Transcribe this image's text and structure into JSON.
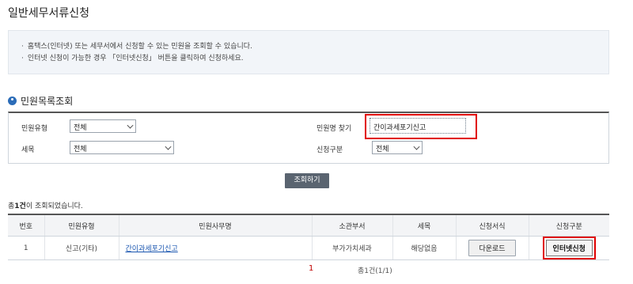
{
  "page_title": "일반세무서류신청",
  "notice": [
    "홈택스(인터넷) 또는 세무서에서 신청할 수 있는 민원을 조회할 수 있습니다.",
    "인터넷 신청이 가능한 경우 「인터넷신청」 버튼을 클릭하여 신청하세요."
  ],
  "section_title": "민원목록조회",
  "search": {
    "type_label": "민원유형",
    "type_value": "전체",
    "tax_label": "세목",
    "tax_value": "전체",
    "name_label": "민원명 찾기",
    "name_value": "간이과세포기신고",
    "apply_label": "신청구분",
    "apply_value": "전체",
    "button_label": "조회하기"
  },
  "result_count_prefix": "총",
  "result_count_number": "1건",
  "result_count_suffix": "이 조회되었습니다.",
  "table": {
    "headers": [
      "번호",
      "민원유형",
      "민원사무명",
      "소관부서",
      "세목",
      "신청서식",
      "신청구분"
    ],
    "rows": [
      {
        "no": "1",
        "type": "신고(기타)",
        "name": "간이과세포기신고",
        "dept": "부가가치세과",
        "tax": "해당없음",
        "form_button": "다운로드",
        "apply_button": "인터넷신청"
      }
    ]
  },
  "pager": {
    "current_page": "1",
    "total": "총1건(1/1)"
  },
  "colors": {
    "highlight_red": "#e00000",
    "accent_blue": "#2b6cb8",
    "button_dark": "#5a6470"
  }
}
